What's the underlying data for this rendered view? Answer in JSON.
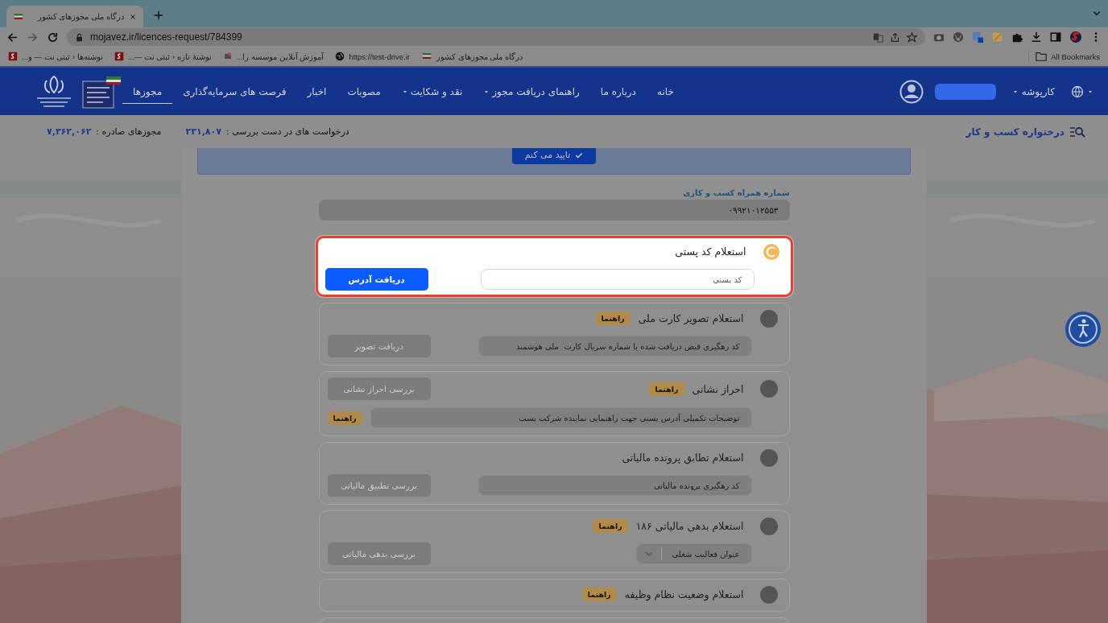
{
  "browser": {
    "tab": {
      "title": "درگاه ملی مجوزهای کشور"
    },
    "url": "mojavez.ir/licences-request/784399",
    "bookmarks": [
      {
        "label": "درگاه ملی مجوزهای کشور",
        "kind": "flag"
      },
      {
        "label": "https://test-drive.ir",
        "kind": "globe"
      },
      {
        "label": "آموزش آنلاین موسسه را...",
        "kind": "course"
      },
      {
        "label": "نوشتهٔ تازه ‹ ثبتی نت —...",
        "kind": "site"
      },
      {
        "label": "نوشته‌ها ‹ ثبتی نت — و...",
        "kind": "site"
      }
    ],
    "all_bookmarks": "All Bookmarks"
  },
  "site_nav": {
    "items": [
      {
        "label": "خانه",
        "dropdown": false,
        "selected": false
      },
      {
        "label": "درباره ما",
        "dropdown": false,
        "selected": false
      },
      {
        "label": "راهنمای دریافت مجوز",
        "dropdown": true,
        "selected": false
      },
      {
        "label": "نقد و شکایت",
        "dropdown": true,
        "selected": false
      },
      {
        "label": "مصوبات",
        "dropdown": false,
        "selected": false
      },
      {
        "label": "اخبار",
        "dropdown": false,
        "selected": false
      },
      {
        "label": "فرصت های سرمایه‌گذاری",
        "dropdown": false,
        "selected": false
      },
      {
        "label": "مجوزها",
        "dropdown": false,
        "selected": true
      }
    ],
    "workspace": "کارپوشه"
  },
  "stats": {
    "title": "درختواره کسب و کار",
    "pending_label": "درخواست های در دست بررسی :",
    "pending_value": "۲۳۱,۸۰۷",
    "issued_label": "مجوزهای صادره :",
    "issued_value": "۷,۳۶۲,۰۶۲"
  },
  "confirm_button": "تایید می کنم",
  "phone": {
    "label": "شماره همراه کسب و کاری",
    "value": "۰۹۹۲۱۰۱۲۵۵۳"
  },
  "inquiries": [
    {
      "kind": "standard",
      "title": "استعلام کد پستی",
      "active": true,
      "field": {
        "kind": "text",
        "placeholder": "کد پستی"
      },
      "button": {
        "label": "دریافت آدرس",
        "disabled": false
      }
    },
    {
      "kind": "standard",
      "title": "استعلام تصویر کارت ملی",
      "help": "راهنما",
      "active": false,
      "field": {
        "kind": "text",
        "placeholder": "کد رهگیری قبض دریافت شده یا شماره سریال کارت  ملی هوشمند"
      },
      "button": {
        "label": "دریافت تصویر",
        "disabled": true
      }
    },
    {
      "kind": "inline",
      "title": "احراز نشانی",
      "help": "راهنما",
      "active": false,
      "field": {
        "kind": "text",
        "placeholder": "توضیحات تکمیلی آدرس پستی جهت راهنمایی نماینده شرکت پست",
        "help": "راهنما"
      },
      "button": {
        "label": "بررسی احراز نشانی",
        "disabled": true
      }
    },
    {
      "kind": "standard",
      "title": "استعلام تطابق پرونده مالیاتی",
      "active": false,
      "field": {
        "kind": "text",
        "placeholder": "کد رهگیری پرونده مالیاتی"
      },
      "button": {
        "label": "بررسی تطبیق مالیاتی",
        "disabled": true
      }
    },
    {
      "kind": "standard",
      "title": "استعلام بدهی مالیاتی ۱۸۶",
      "help": "راهنما",
      "active": false,
      "field": {
        "kind": "select",
        "placeholder": "عنوان فعالیت شغلی"
      },
      "button": {
        "label": "بررسی بدهی مالیاتی",
        "disabled": true
      }
    },
    {
      "kind": "title-only",
      "title": "استعلام وضعیت نظام وظیفه",
      "help": "راهنما",
      "active": false
    }
  ]
}
